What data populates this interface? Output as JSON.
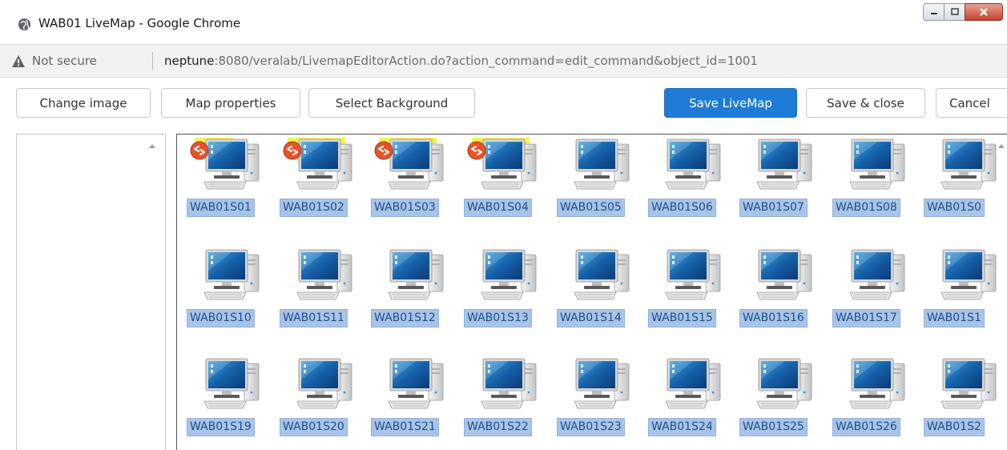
{
  "window": {
    "title": "WAB01 LiveMap - Google Chrome"
  },
  "addressbar": {
    "security_label": "Not secure",
    "url_host": "neptune",
    "url_rest": ":8080/veralab/LivemapEditorAction.do?action_command=edit_command&object_id=1001"
  },
  "toolbar": {
    "change_image": "Change image",
    "map_properties": "Map properties",
    "select_background": "Select Background",
    "save_livemap": "Save LiveMap",
    "save_close": "Save & close",
    "cancel": "Cancel"
  },
  "colors": {
    "primary_button": "#1e7bd6",
    "label_bg": "#a9c4e8",
    "highlight": "#ebf014",
    "remote_badge": "#e8542a"
  },
  "computers": [
    {
      "label": "WAB01S01",
      "remote": true
    },
    {
      "label": "WAB01S02",
      "remote": true
    },
    {
      "label": "WAB01S03",
      "remote": true
    },
    {
      "label": "WAB01S04",
      "remote": true
    },
    {
      "label": "WAB01S05",
      "remote": false
    },
    {
      "label": "WAB01S06",
      "remote": false
    },
    {
      "label": "WAB01S07",
      "remote": false
    },
    {
      "label": "WAB01S08",
      "remote": false
    },
    {
      "label": "WAB01S0",
      "remote": false
    },
    {
      "label": "WAB01S10",
      "remote": false
    },
    {
      "label": "WAB01S11",
      "remote": false
    },
    {
      "label": "WAB01S12",
      "remote": false
    },
    {
      "label": "WAB01S13",
      "remote": false
    },
    {
      "label": "WAB01S14",
      "remote": false
    },
    {
      "label": "WAB01S15",
      "remote": false
    },
    {
      "label": "WAB01S16",
      "remote": false
    },
    {
      "label": "WAB01S17",
      "remote": false
    },
    {
      "label": "WAB01S1",
      "remote": false
    },
    {
      "label": "WAB01S19",
      "remote": false
    },
    {
      "label": "WAB01S20",
      "remote": false
    },
    {
      "label": "WAB01S21",
      "remote": false
    },
    {
      "label": "WAB01S22",
      "remote": false
    },
    {
      "label": "WAB01S23",
      "remote": false
    },
    {
      "label": "WAB01S24",
      "remote": false
    },
    {
      "label": "WAB01S25",
      "remote": false
    },
    {
      "label": "WAB01S26",
      "remote": false
    },
    {
      "label": "WAB01S2",
      "remote": false
    }
  ]
}
